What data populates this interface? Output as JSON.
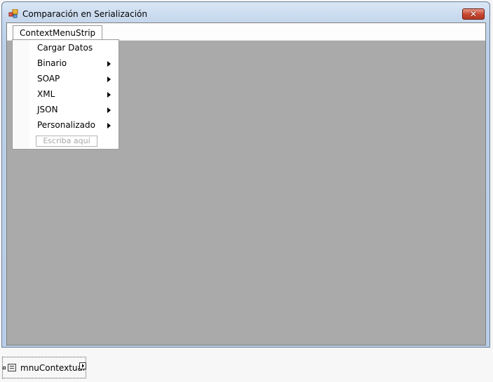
{
  "window": {
    "title": "Comparación en Serialización",
    "close_icon": "close-icon"
  },
  "menustrip": {
    "root_label": "ContextMenuStrip",
    "items": [
      {
        "label": "Cargar Datos",
        "submenu": false
      },
      {
        "label": "Binario",
        "submenu": true
      },
      {
        "label": "SOAP",
        "submenu": true
      },
      {
        "label": "XML",
        "submenu": true
      },
      {
        "label": "JSON",
        "submenu": true
      },
      {
        "label": "Personalizado",
        "submenu": true
      }
    ],
    "type_here_placeholder": "Escriba aquí"
  },
  "component_tray": {
    "component_label": "mnuContextual",
    "component_icon": "context-menu-icon"
  },
  "colors": {
    "client_background": "#aaaaaa",
    "title_bar": "#c4d6ec",
    "close_button": "#c7452f"
  }
}
